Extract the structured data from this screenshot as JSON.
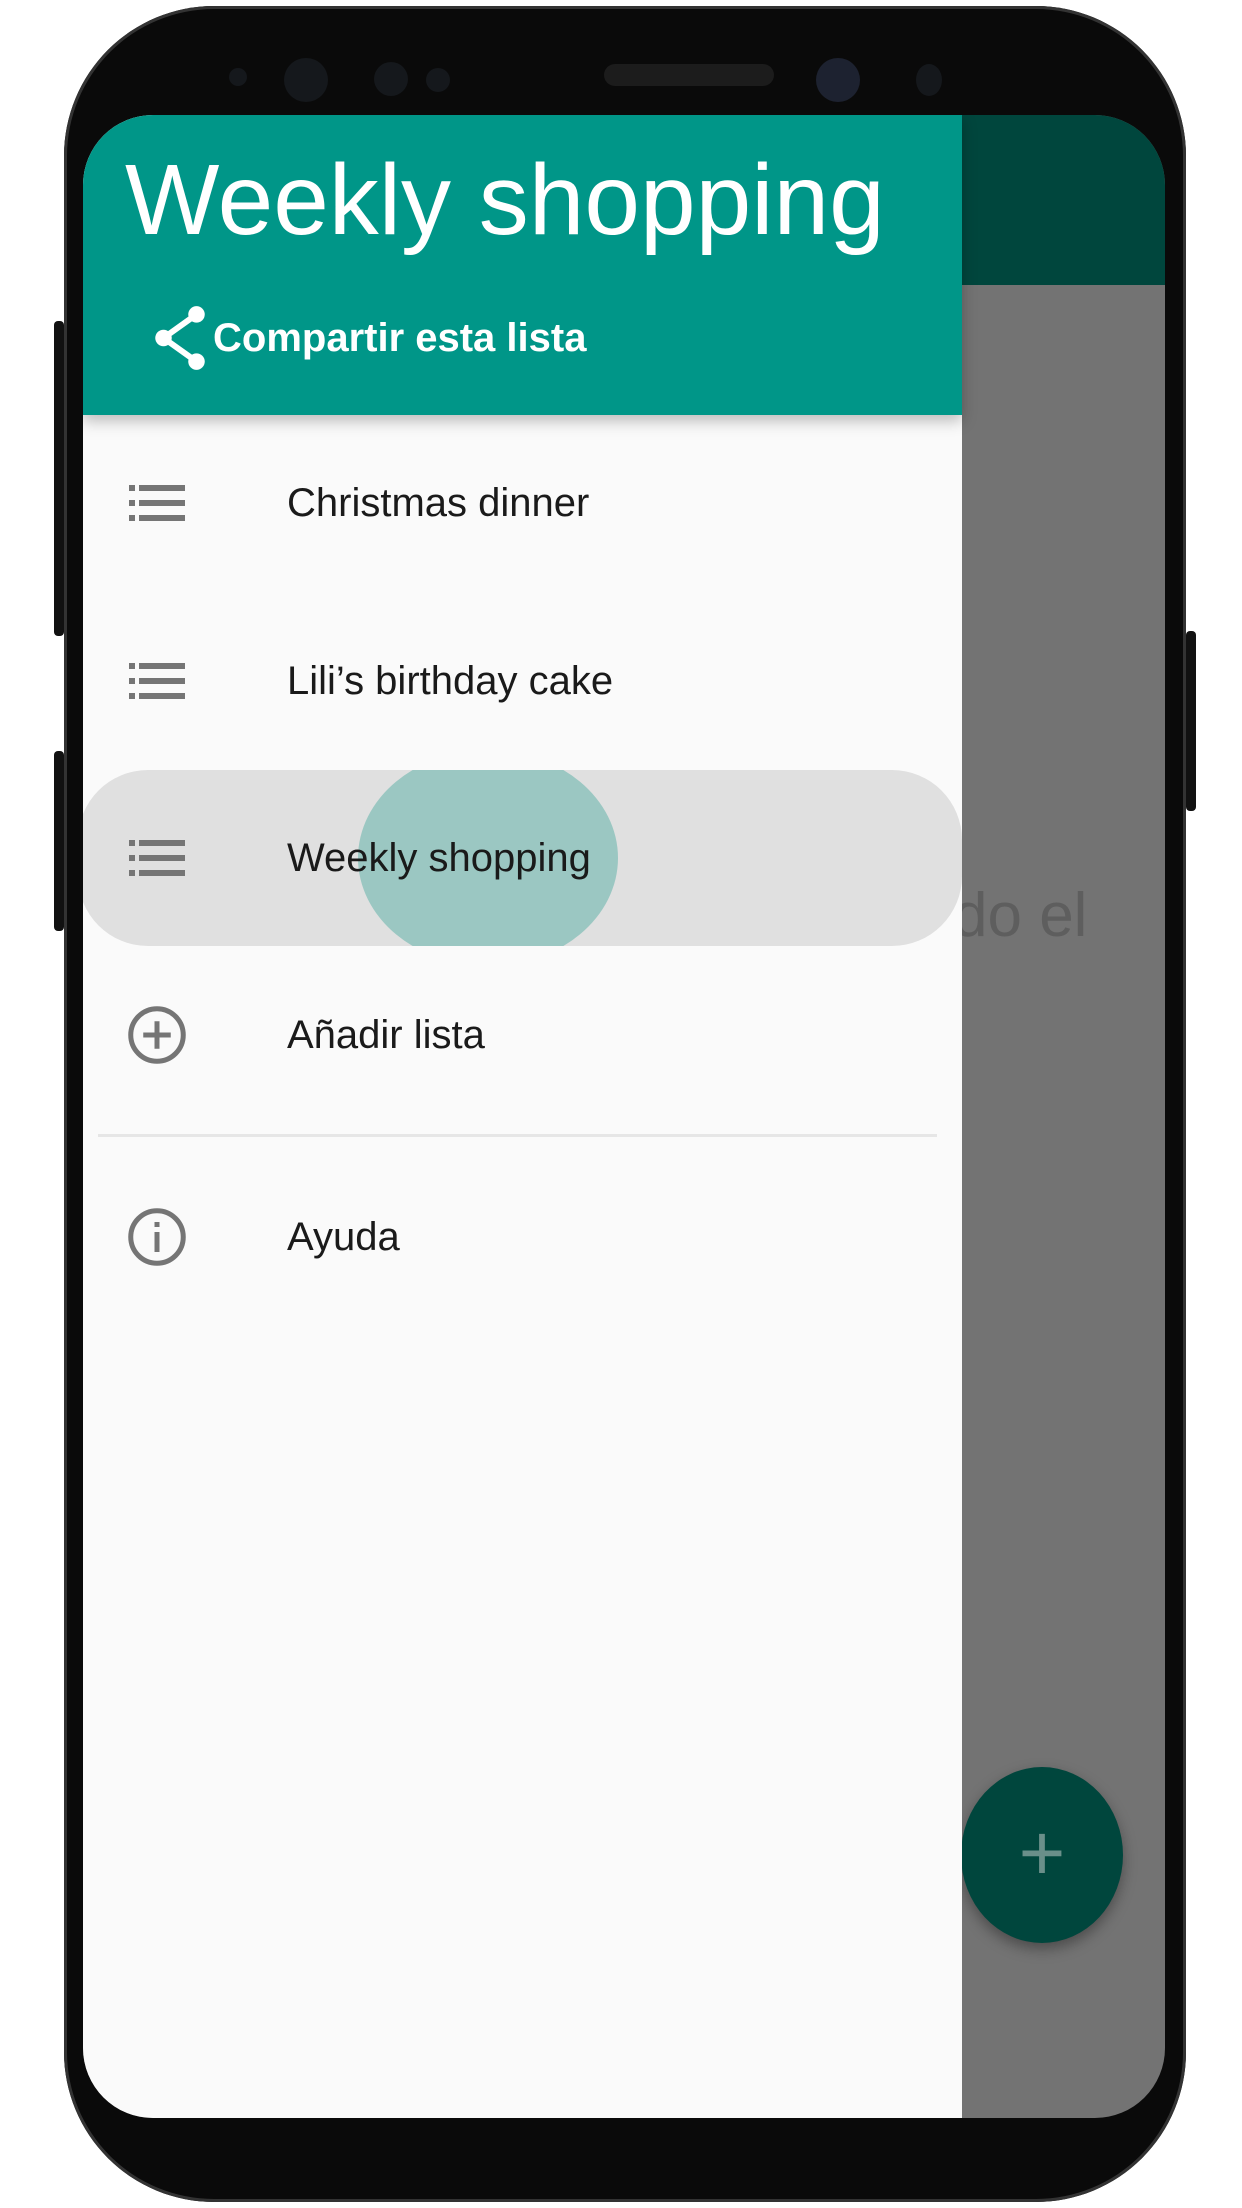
{
  "drawer": {
    "title": "Weekly shopping",
    "share_label": "Compartir esta lista",
    "lists": [
      {
        "label": "Christmas dinner",
        "icon": "list-icon"
      },
      {
        "label": "Lili’s birthday cake",
        "icon": "list-icon"
      },
      {
        "label": "Weekly shopping",
        "icon": "list-icon",
        "active": true
      }
    ],
    "add_list": {
      "label": "Añadir lista",
      "icon": "add-circle-icon"
    },
    "help": {
      "label": "Ayuda",
      "icon": "info-icon"
    }
  },
  "background": {
    "partial_text": "do el",
    "fab_label": "+"
  },
  "colors": {
    "primary": "#009688",
    "primary_dark": "#00463d",
    "ripple": "#9bc7c2"
  }
}
